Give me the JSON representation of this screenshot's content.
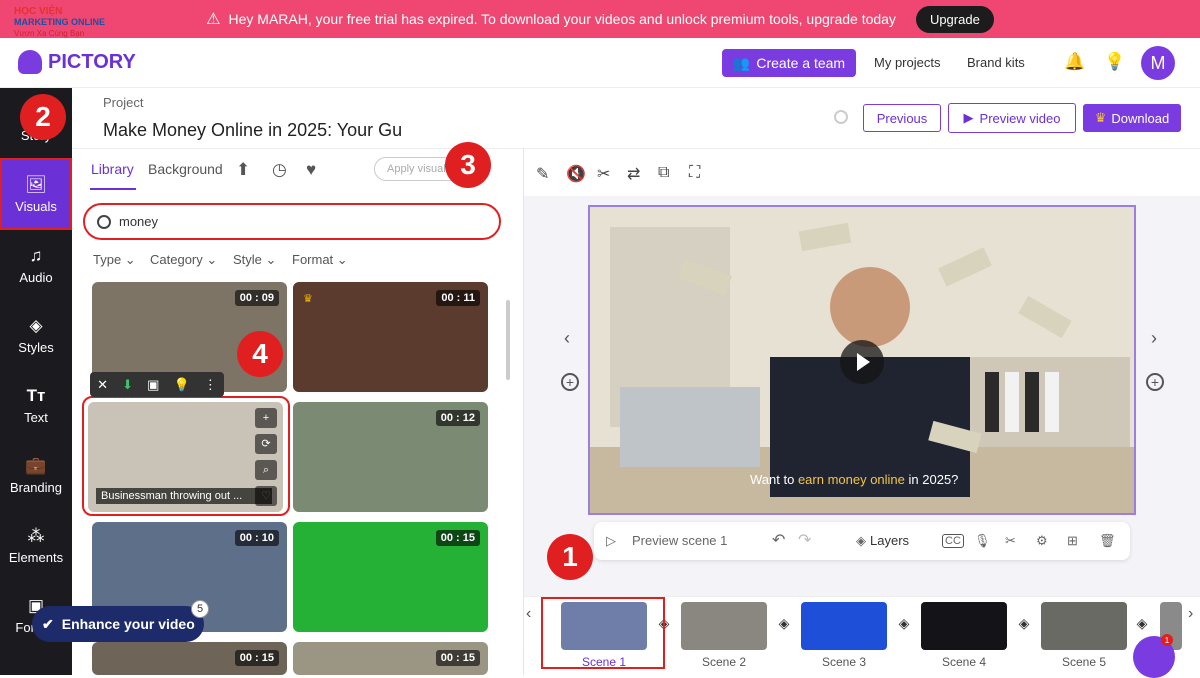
{
  "banner": {
    "message": "Hey MARAH, your free trial has expired. To download your videos and unlock premium tools, upgrade today",
    "upgrade_label": "Upgrade"
  },
  "watermark": {
    "line1": "HỌC VIỆN",
    "line2": "MARKETING ONLINE",
    "line3": "Vươn Xa Cùng Bạn"
  },
  "header": {
    "logo": "PICTORY",
    "create_team": "Create a team",
    "my_projects": "My projects",
    "brand_kits": "Brand kits",
    "avatar_letter": "M"
  },
  "project": {
    "label": "Project",
    "title": "Make Money Online in 2025: Your Gu"
  },
  "actions": {
    "previous": "Previous",
    "preview_video": "Preview video",
    "download": "Download"
  },
  "sidebar": {
    "items": [
      {
        "label": "Story",
        "icon": "story-icon"
      },
      {
        "label": "Visuals",
        "icon": "image-icon"
      },
      {
        "label": "Audio",
        "icon": "music-icon"
      },
      {
        "label": "Styles",
        "icon": "styles-icon"
      },
      {
        "label": "Text",
        "icon": "text-icon"
      },
      {
        "label": "Branding",
        "icon": "briefcase-icon"
      },
      {
        "label": "Elements",
        "icon": "elements-icon"
      },
      {
        "label": "Format",
        "icon": "format-icon"
      }
    ]
  },
  "library": {
    "tabs": [
      "Library",
      "Background"
    ],
    "apply_label": "Apply visual",
    "search_value": "money",
    "filters": [
      "Type",
      "Category",
      "Style",
      "Format"
    ],
    "thumbs": [
      {
        "duration": "00 : 09",
        "color": "#7d7466"
      },
      {
        "duration": "00 : 11",
        "color": "#5a3b2d",
        "premium": true
      },
      {
        "duration": "",
        "color": "#c9c2b6",
        "caption": "Businessman throwing out ..."
      },
      {
        "duration": "00 : 12",
        "color": "#7b8a72"
      },
      {
        "duration": "00 : 10",
        "color": "#5e6f8a"
      },
      {
        "duration": "00 : 15",
        "color": "#25b135"
      },
      {
        "duration": "00 : 15",
        "color": "#6e6458"
      },
      {
        "duration": "00 : 15",
        "color": "#9b9684"
      }
    ]
  },
  "annotations": [
    "1",
    "2",
    "3",
    "4"
  ],
  "enhance": {
    "label": "Enhance your video",
    "count": "5"
  },
  "preview": {
    "caption_pre": "Want to ",
    "caption_hl": "earn money online",
    "caption_post": " in 2025?"
  },
  "scene_bar": {
    "preview_scene": "Preview scene 1",
    "layers": "Layers"
  },
  "scenes": [
    {
      "label": "Scene 1",
      "color": "#6f7ea8"
    },
    {
      "label": "Scene 2",
      "color": "#8a8780"
    },
    {
      "label": "Scene 3",
      "color": "#1d4fd8"
    },
    {
      "label": "Scene 4",
      "color": "#141418"
    },
    {
      "label": "Scene 5",
      "color": "#6a6a64"
    }
  ],
  "chat": {
    "badge": "1"
  },
  "colors": {
    "accent": "#7a3ce0",
    "banner": "#ef4771",
    "annotation": "#e02020"
  }
}
